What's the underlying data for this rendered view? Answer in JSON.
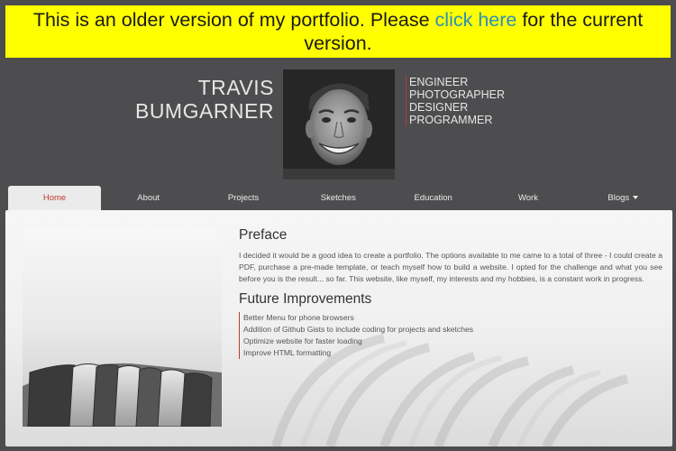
{
  "notice": {
    "text_before": "This is an older version of my portfolio. Please ",
    "link": "click here",
    "text_after": " for the current version."
  },
  "header": {
    "first_name": "TRAVIS",
    "last_name": "BUMGARNER",
    "roles": [
      "ENGINEER",
      "PHOTOGRAPHER",
      "DESIGNER",
      "PROGRAMMER"
    ]
  },
  "nav": {
    "items": [
      "Home",
      "About",
      "Projects",
      "Sketches",
      "Education",
      "Work",
      "Blogs"
    ],
    "active": "Home"
  },
  "main": {
    "preface_title": "Preface",
    "preface_text": "I decided it would be a good idea to create a portfolio. The options available to me came to a total of three - I could create a PDF, purchase a pre-made template, or teach myself how to build a website. I opted for the challenge and what you see before you is the result... so far. This website, like myself, my interests and my hobbies, is a constant work in progress.",
    "improvements_title": "Future Improvements",
    "improvements": [
      "Better Menu for phone browsers",
      "Addition of Github Gists to include coding for projects and sketches",
      "Optimize website for faster loading",
      "Improve HTML formatting"
    ]
  },
  "colors": {
    "background": "#4d4d4f",
    "notice_bg": "#ffff00",
    "link": "#2b8fb8",
    "accent": "#c0392b"
  }
}
